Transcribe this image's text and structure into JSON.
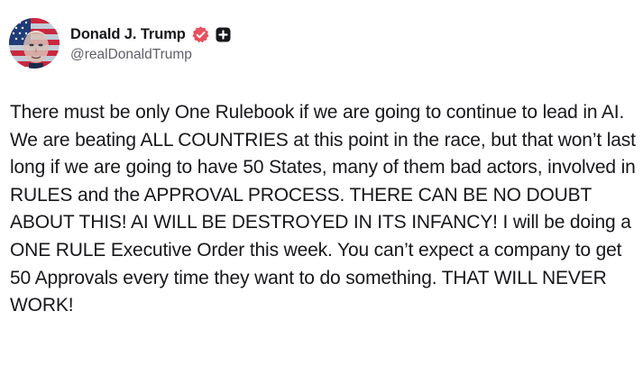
{
  "author": {
    "display_name": "Donald J. Trump",
    "handle": "@realDonaldTrump",
    "avatar_icon": "avatar-image",
    "verified_icon": "verified-badge-icon",
    "follow_icon": "plus-square-icon"
  },
  "post": {
    "text": "There must be only One Rulebook if we are going to continue to lead in AI. We are beating ALL COUNTRIES at this point in the race, but that won’t last long if we are going to have 50 States, many of them bad actors, involved in RULES and the APPROVAL PROCESS. THERE CAN BE NO DOUBT ABOUT THIS! AI WILL BE DESTROYED IN ITS INFANCY! I will be doing a ONE RULE Executive Order this week. You can’t expect a company to get 50 Approvals every time they want to do something. THAT WILL NEVER WORK!"
  },
  "colors": {
    "text_primary": "#17171b",
    "text_secondary": "#5e5e6a",
    "verified_badge": "#e8515f",
    "background": "#ffffff"
  }
}
